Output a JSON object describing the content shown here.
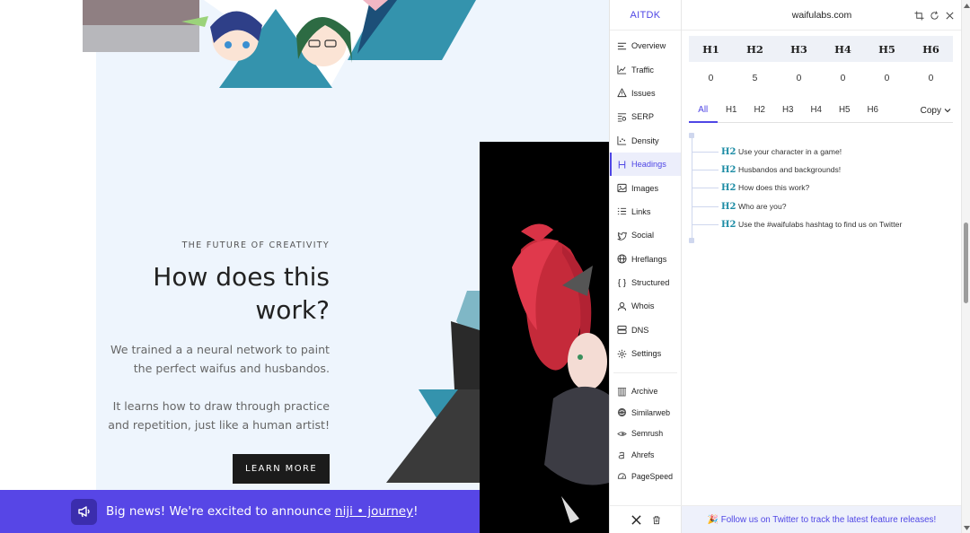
{
  "website": {
    "eyebrow": "THE FUTURE OF CREATIVITY",
    "headline_line1": "How does this",
    "headline_line2": "work?",
    "para1_line1": "We trained a a neural network to paint",
    "para1_line2": "the perfect waifus and husbandos.",
    "para2_line1": "It learns how to draw through practice",
    "para2_line2": "and repetition, just like a human artist!",
    "learn_more": "LEARN MORE",
    "news_text": "Big news! We're excited to announce ",
    "news_link": "niji • journey",
    "news_suffix": "!",
    "news_icon": "megaphone-icon"
  },
  "extension": {
    "brand": "AITDK",
    "domain": "waifulabs.com",
    "header_icons": [
      "crop-icon",
      "refresh-icon",
      "close-icon"
    ],
    "nav": [
      {
        "label": "Overview",
        "icon": "list-icon"
      },
      {
        "label": "Traffic",
        "icon": "chart-line-icon"
      },
      {
        "label": "Issues",
        "icon": "warning-icon"
      },
      {
        "label": "SERP",
        "icon": "serp-icon"
      },
      {
        "label": "Density",
        "icon": "scatter-icon"
      },
      {
        "label": "Headings",
        "icon": "heading-icon"
      },
      {
        "label": "Images",
        "icon": "image-icon"
      },
      {
        "label": "Links",
        "icon": "links-icon"
      },
      {
        "label": "Social",
        "icon": "twitter-bird-icon"
      },
      {
        "label": "Hreflangs",
        "icon": "globe-icon"
      },
      {
        "label": "Structured",
        "icon": "braces-icon"
      },
      {
        "label": "Whois",
        "icon": "user-icon"
      },
      {
        "label": "DNS",
        "icon": "server-icon"
      },
      {
        "label": "Settings",
        "icon": "gear-icon"
      }
    ],
    "active_nav": "Headings",
    "tools": [
      {
        "label": "Archive",
        "icon": "archive-icon"
      },
      {
        "label": "Similarweb",
        "icon": "similarweb-icon"
      },
      {
        "label": "Semrush",
        "icon": "semrush-icon"
      },
      {
        "label": "Ahrefs",
        "icon": "ahrefs-icon"
      },
      {
        "label": "PageSpeed",
        "icon": "speedometer-icon"
      }
    ],
    "heading_counts": {
      "labels": [
        "H1",
        "H2",
        "H3",
        "H4",
        "H5",
        "H6"
      ],
      "values": [
        "0",
        "5",
        "0",
        "0",
        "0",
        "0"
      ]
    },
    "tabs": [
      "All",
      "H1",
      "H2",
      "H3",
      "H4",
      "H5",
      "H6"
    ],
    "active_tab": "All",
    "copy_label": "Copy",
    "headings": [
      {
        "tag": "H2",
        "text": "Use your character in a game!"
      },
      {
        "tag": "H2",
        "text": "Husbandos and backgrounds!"
      },
      {
        "tag": "H2",
        "text": "How does this work?"
      },
      {
        "tag": "H2",
        "text": "Who are you?"
      },
      {
        "tag": "H2",
        "text": "Use the #waifulabs hashtag to find us on Twitter"
      }
    ],
    "footer_text": "🎉 Follow us on Twitter to track the latest feature releases!",
    "footer_icons": [
      "x-logo-icon",
      "trash-icon"
    ]
  },
  "colors": {
    "accent": "#4f46e5",
    "news_bar": "#5746e6",
    "teal": "#2f8fa7",
    "panel_bg": "#eef5fd"
  }
}
